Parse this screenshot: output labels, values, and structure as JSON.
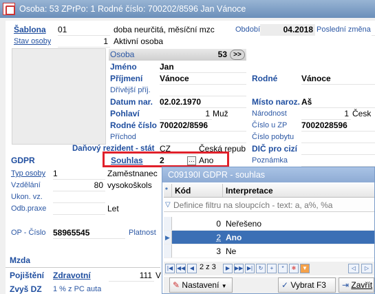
{
  "titlebar": {
    "text": "Osoba: 53   ZPrPo: 1    Rodné číslo: 700202/8596    Jan Vánoce"
  },
  "form": {
    "sablona_label": "Šablona",
    "sablona_value": "01",
    "sablona_text": "doba neurčitá, měsíční mzc",
    "obdobi_label": "Období",
    "obdobi_value": "04.2018",
    "posledni_zmena_label": "Poslední změna",
    "stav_osoby_label": "Stav osoby",
    "stav_osoby_value": "1",
    "stav_osoby_text": "Aktivní osoba",
    "osoba_label": "Osoba",
    "osoba_value": "53",
    "osoba_nav": ">>",
    "jmeno_label": "Jméno",
    "jmeno_value": "Jan",
    "prijmeni_label": "Příjmení",
    "prijmeni_value": "Vánoce",
    "rodne_label": "Rodné",
    "rodne_value": "Vánoce",
    "drivejsi_label": "Dřívější příj.",
    "datum_nar_label": "Datum nar.",
    "datum_nar_value": "02.02.1970",
    "misto_label": "Místo naroz.",
    "misto_value": "Aš",
    "pohlavi_label": "Pohlaví",
    "pohlavi_value": "1",
    "pohlavi_text": "Muž",
    "narodnost_label": "Národnost",
    "narodnost_value": "1",
    "narodnost_text": "Česk",
    "rodne_cislo_label": "Rodné číslo",
    "rodne_cislo_value": "700202/8596",
    "cislo_zp_label": "Číslo u ZP",
    "cislo_zp_value": "7002028596",
    "prichod_label": "Příchod",
    "cislo_pobytu_label": "Číslo pobytu",
    "danovy_label": "Daňový rezident - stát",
    "danovy_value": "CZ",
    "danovy_text": "Česká repub",
    "dic_label": "DIČ pro cizí",
    "gdpr_label": "GDPR",
    "souhlas_label": "Souhlas",
    "souhlas_value": "2",
    "souhlas_text": "Ano",
    "poznamka_label": "Poznámka",
    "typ_osoby_label": "Typ osoby",
    "typ_osoby_value": "1",
    "typ_osoby_text": "Zaměstnanec",
    "vzdelani_label": "Vzdělání",
    "vzdelani_value": "80",
    "vzdelani_text": "vysokoškols",
    "ukon_label": "Ukon. vz.",
    "odb_praxe_label": "Odb.praxe",
    "odb_praxe_text": "Let",
    "op_label": "OP - Číslo",
    "op_value": "58965545",
    "platnost_label": "Platnost",
    "mzda_label": "Mzda",
    "pojisteni_label": "Pojištění",
    "zdravotni_label": "Zdravotní",
    "zdravotni_value": "111",
    "zdravotni_text": "V",
    "zvys_label": "Zvyš DZ",
    "zvys_text": "1 % z PC auta"
  },
  "popup": {
    "title": "C09190I GDPR - souhlas",
    "col_kod": "Kód",
    "col_interpretace": "Interpretace",
    "filter_text": "Definice filtru na sloupcích - text: a, a%, %a",
    "rows": [
      {
        "kod": "0",
        "text": "Neřešeno"
      },
      {
        "kod": "2",
        "text": "Ano"
      },
      {
        "kod": "3",
        "text": "Ne"
      }
    ],
    "page_text": "2 z 3",
    "nastaveni_label": "Nastavení",
    "vybrat_label": "Vybrat F3",
    "zavrit_label": "Zavřít"
  }
}
